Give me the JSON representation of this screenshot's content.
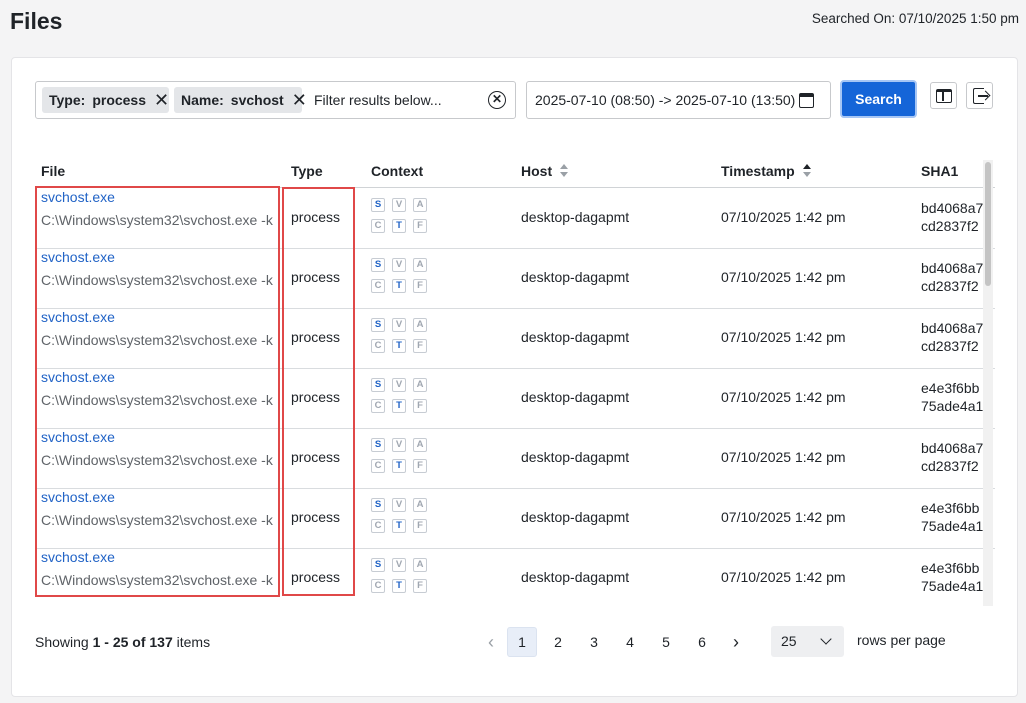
{
  "page": {
    "title": "Files",
    "searched_on": "Searched On: 07/10/2025 1:50 pm"
  },
  "filters": {
    "chips": [
      {
        "key": "Type:",
        "value": "process"
      },
      {
        "key": "Name:",
        "value": "svchost"
      }
    ],
    "placeholder": "Filter results below..."
  },
  "date_range": "2025-07-10 (08:50) -> 2025-07-10 (13:50)",
  "search_label": "Search",
  "columns": {
    "file": "File",
    "type": "Type",
    "context": "Context",
    "host": "Host",
    "timestamp": "Timestamp",
    "sha1": "SHA1"
  },
  "context_badges": {
    "top": [
      "S",
      "V",
      "A"
    ],
    "bottom": [
      "C",
      "T",
      "F"
    ]
  },
  "rows": [
    {
      "name": "svchost.exe",
      "path": "C:\\Windows\\system32\\svchost.exe -k",
      "type": "process",
      "host": "desktop-dagapmt",
      "timestamp": "07/10/2025 1:42 pm",
      "sha1_1": "bd4068a7",
      "sha1_2": "cd2837f2"
    },
    {
      "name": "svchost.exe",
      "path": "C:\\Windows\\system32\\svchost.exe -k",
      "type": "process",
      "host": "desktop-dagapmt",
      "timestamp": "07/10/2025 1:42 pm",
      "sha1_1": "bd4068a7",
      "sha1_2": "cd2837f2"
    },
    {
      "name": "svchost.exe",
      "path": "C:\\Windows\\system32\\svchost.exe -k",
      "type": "process",
      "host": "desktop-dagapmt",
      "timestamp": "07/10/2025 1:42 pm",
      "sha1_1": "bd4068a7",
      "sha1_2": "cd2837f2"
    },
    {
      "name": "svchost.exe",
      "path": "C:\\Windows\\system32\\svchost.exe -k",
      "type": "process",
      "host": "desktop-dagapmt",
      "timestamp": "07/10/2025 1:42 pm",
      "sha1_1": "e4e3f6bb",
      "sha1_2": "75ade4a1"
    },
    {
      "name": "svchost.exe",
      "path": "C:\\Windows\\system32\\svchost.exe -k",
      "type": "process",
      "host": "desktop-dagapmt",
      "timestamp": "07/10/2025 1:42 pm",
      "sha1_1": "bd4068a7",
      "sha1_2": "cd2837f2"
    },
    {
      "name": "svchost.exe",
      "path": "C:\\Windows\\system32\\svchost.exe -k",
      "type": "process",
      "host": "desktop-dagapmt",
      "timestamp": "07/10/2025 1:42 pm",
      "sha1_1": "e4e3f6bb",
      "sha1_2": "75ade4a1"
    },
    {
      "name": "svchost.exe",
      "path": "C:\\Windows\\system32\\svchost.exe -k",
      "type": "process",
      "host": "desktop-dagapmt",
      "timestamp": "07/10/2025 1:42 pm",
      "sha1_1": "e4e3f6bb",
      "sha1_2": "75ade4a1"
    }
  ],
  "footer": {
    "showing_prefix": "Showing",
    "showing_range": "1 - 25 of 137",
    "showing_suffix": "items",
    "pages": [
      "1",
      "2",
      "3",
      "4",
      "5",
      "6"
    ],
    "prev": "‹",
    "next": "›",
    "rows_per_page": "25",
    "rows_label": "rows per page"
  }
}
